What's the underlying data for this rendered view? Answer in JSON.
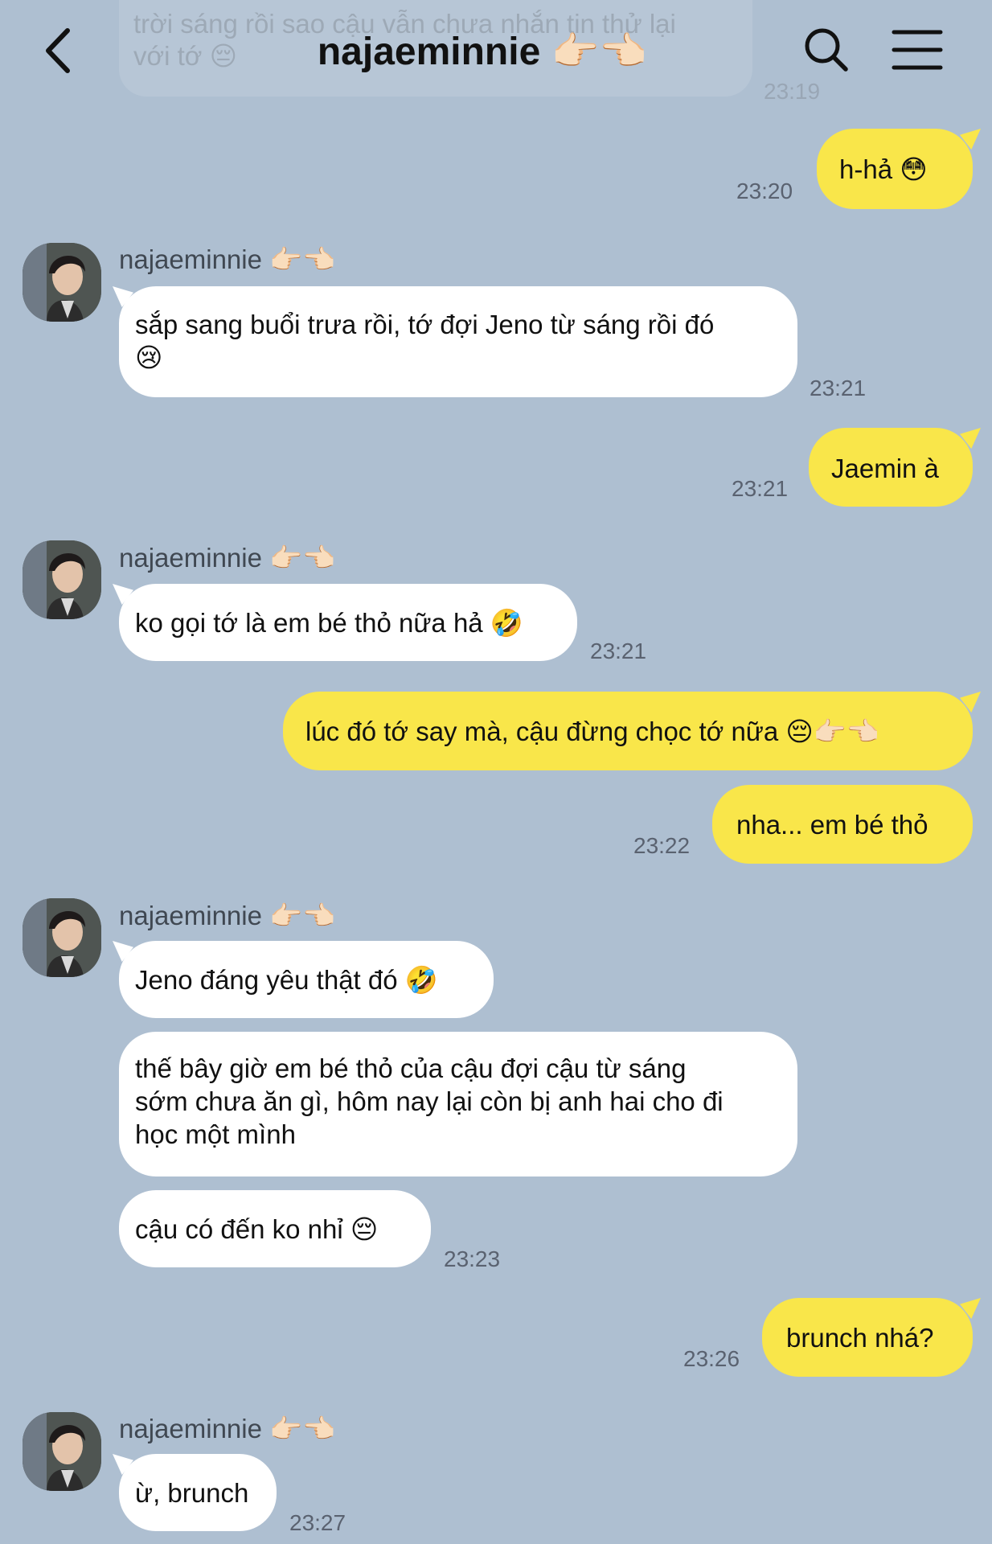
{
  "header": {
    "title": "najaeminnie 👉🏻👈🏻"
  },
  "ghost": {
    "text_line1": "trời sáng rồi sao cậu vẫn chưa nhắn tin thử lại",
    "text_line2": "với tớ 😔",
    "time": "23:19"
  },
  "contact": {
    "name": "najaeminnie 👉🏻👈🏻"
  },
  "messages": [
    {
      "from": "me",
      "text": "h-hả 😳",
      "time": "23:20"
    },
    {
      "from": "them",
      "line1": "sắp sang buổi trưa rồi, tớ đợi Jeno từ sáng rồi đó",
      "line2": "😢",
      "time": "23:21"
    },
    {
      "from": "me",
      "text": "Jaemin à",
      "time": "23:21"
    },
    {
      "from": "them",
      "text": "ko gọi tớ là em bé thỏ nữa hả 🤣",
      "time": "23:21"
    },
    {
      "from": "me",
      "text": "lúc đó tớ say mà, cậu đừng chọc tớ nữa 😔👉🏻👈🏻"
    },
    {
      "from": "me",
      "text": "nha... em bé thỏ",
      "time": "23:22"
    },
    {
      "from": "them",
      "text": "Jeno đáng yêu thật đó 🤣"
    },
    {
      "from": "them",
      "line1": "thế bây giờ em bé thỏ của cậu đợi cậu từ sáng",
      "line2": "sớm chưa ăn gì, hôm nay lại còn bị anh hai cho đi",
      "line3": "học một mình"
    },
    {
      "from": "them",
      "text": "cậu có đến ko nhỉ 😔",
      "time": "23:23"
    },
    {
      "from": "me",
      "text": "brunch nhá?",
      "time": "23:26"
    },
    {
      "from": "them",
      "text": "ừ, brunch",
      "time": "23:27"
    }
  ],
  "colors": {
    "background": "#aebfd1",
    "my_bubble": "#f9e64a",
    "their_bubble": "#ffffff"
  },
  "icons": {
    "back": "chevron-left-icon",
    "search": "search-icon",
    "menu": "hamburger-menu-icon"
  }
}
